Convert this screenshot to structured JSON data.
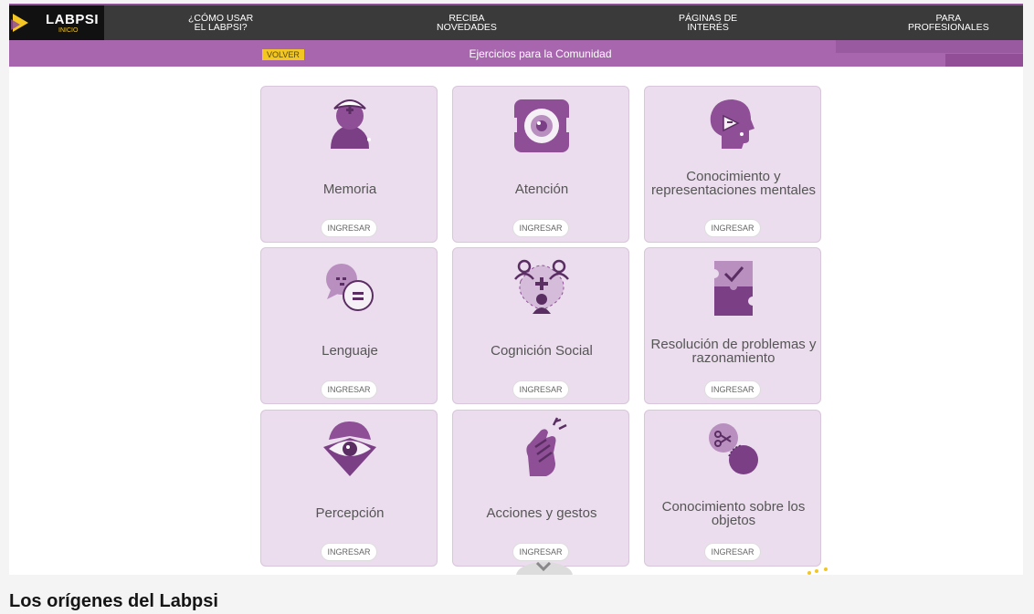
{
  "logo": {
    "name": "LABPSI",
    "sub": "INICIO"
  },
  "nav": [
    {
      "label": "¿CÓMO USAR\nEL LABPSI?"
    },
    {
      "label": "RECIBA\nNOVEDADES"
    },
    {
      "label": "PÁGINAS DE\nINTERÉS"
    },
    {
      "label": "PARA\nPROFESIONALES"
    }
  ],
  "subbar": {
    "back_label": "VOLVER",
    "title": "Ejercicios para la Comunidad"
  },
  "cards": [
    {
      "title": "Memoria",
      "button": "INGRESAR",
      "icon": "brain-memory-icon"
    },
    {
      "title": "Atención",
      "button": "INGRESAR",
      "icon": "eye-focus-icon"
    },
    {
      "title": "Conocimiento y representaciones mentales",
      "button": "INGRESAR",
      "icon": "head-knowledge-icon"
    },
    {
      "title": "Lenguaje",
      "button": "INGRESAR",
      "icon": "speech-bubbles-icon"
    },
    {
      "title": "Cognición Social",
      "button": "INGRESAR",
      "icon": "people-network-icon"
    },
    {
      "title": "Resolución de problemas y razonamiento",
      "button": "INGRESAR",
      "icon": "puzzle-icon"
    },
    {
      "title": "Percepción",
      "button": "INGRESAR",
      "icon": "eye-diamond-icon"
    },
    {
      "title": "Acciones y gestos",
      "button": "INGRESAR",
      "icon": "hand-gesture-icon"
    },
    {
      "title": "Conocimiento sobre los objetos",
      "button": "INGRESAR",
      "icon": "scissors-objects-icon"
    }
  ],
  "colors": {
    "purple": "#8e4f97",
    "yellow": "#f4c622",
    "card": "#ebdded"
  },
  "page_heading": "Los orígenes del Labpsi"
}
